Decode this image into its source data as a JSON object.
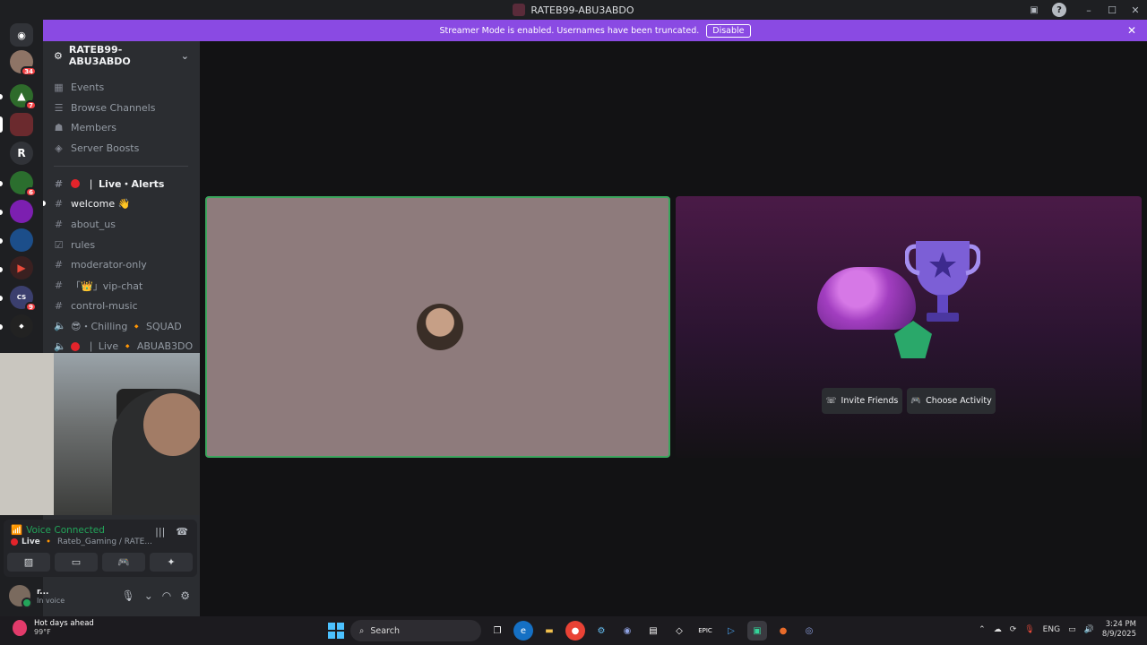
{
  "window": {
    "title": "RATEB99-ABU3ABDO"
  },
  "streamer_bar": {
    "message": "Streamer Mode is enabled. Usernames have been truncated.",
    "disable_label": "Disable"
  },
  "rail": {
    "servers": [
      {
        "badge": "34"
      },
      {
        "badge": "7"
      },
      {
        "badge": ""
      },
      {
        "letter": "R"
      },
      {
        "badge": "6"
      },
      {
        "badge": ""
      },
      {
        "badge": ""
      },
      {
        "badge": ""
      },
      {
        "badge": "9"
      },
      {
        "badge": ""
      }
    ]
  },
  "server": {
    "name": "RATEB99-ABU3ABDO",
    "nav": [
      {
        "label": "Events",
        "icon": "calendar-icon"
      },
      {
        "label": "Browse Channels",
        "icon": "browse-icon"
      },
      {
        "label": "Members",
        "icon": "members-icon"
      },
      {
        "label": "Server Boosts",
        "icon": "boost-icon"
      }
    ],
    "channels": [
      {
        "label": "❘ Live・Alerts",
        "type": "text"
      },
      {
        "label": "welcome 👋",
        "type": "text"
      },
      {
        "label": "about_us",
        "type": "text"
      },
      {
        "label": "rules",
        "type": "rules"
      },
      {
        "label": "moderator-only",
        "type": "text"
      },
      {
        "label": "「👑」vip-chat",
        "type": "text"
      },
      {
        "label": "control-music",
        "type": "text"
      },
      {
        "label": "😎・Chilling 🔸 SQUAD",
        "type": "voice"
      },
      {
        "label": "❘ Live 🔸 ABUAB3DO",
        "type": "voice"
      }
    ]
  },
  "voice": {
    "status": "Voice Connected",
    "live": "Live",
    "location": "Rateb_Gaming / RATE..."
  },
  "user": {
    "name": "r...",
    "status": "In voice"
  },
  "activity": {
    "invite_label": "Invite Friends",
    "choose_label": "Choose Activity"
  },
  "taskbar": {
    "weather_title": "Hot days ahead",
    "weather_temp": "99°F",
    "search_placeholder": "Search",
    "lang": "ENG",
    "time": "3:24 PM",
    "date": "8/9/2025"
  },
  "colors": {
    "blurple": "#8a4ae3",
    "green": "#23a55a",
    "red": "#f23f43"
  }
}
